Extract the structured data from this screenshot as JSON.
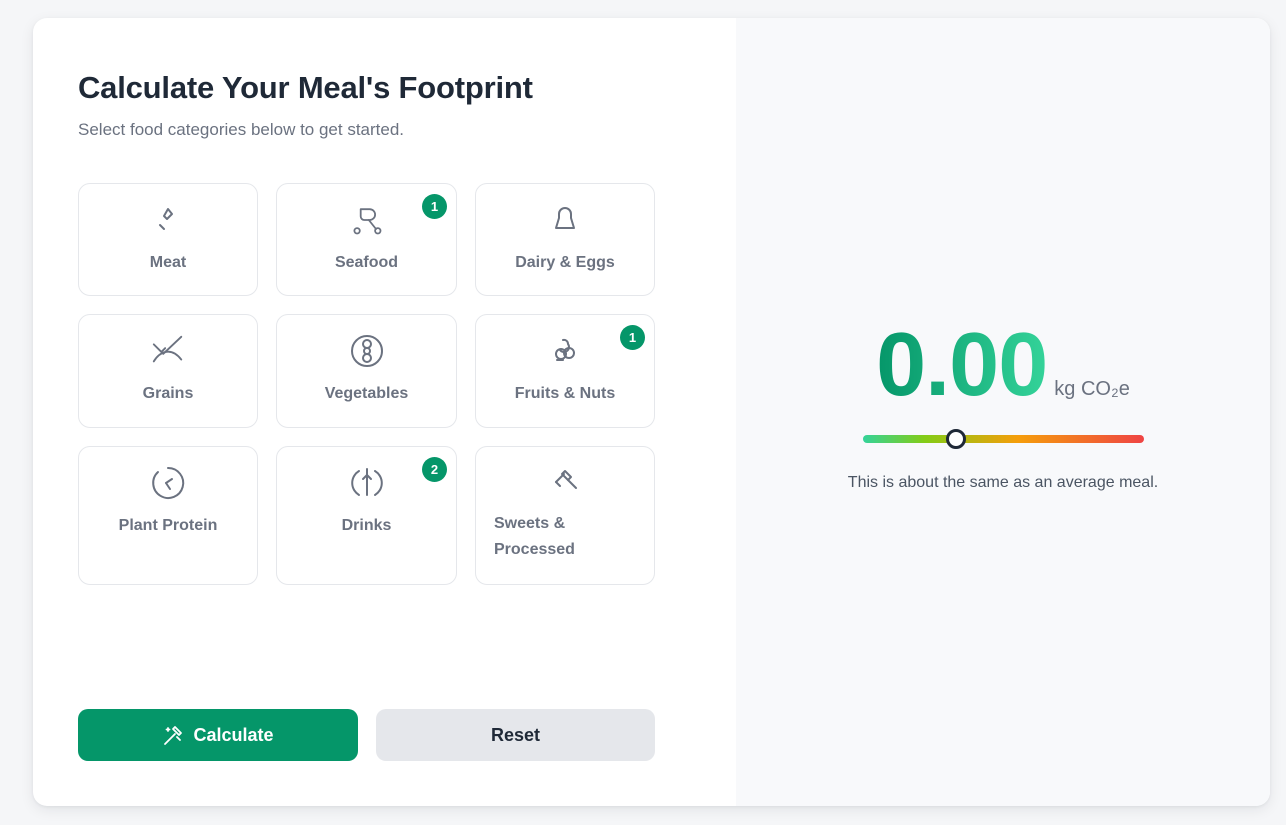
{
  "page": {
    "title": "Calculate Your Meal's Footprint",
    "subtitle": "Select food categories below to get started."
  },
  "categories": [
    {
      "label": "Meat",
      "icon": "meat-icon",
      "count": null
    },
    {
      "label": "Seafood",
      "icon": "seafood-icon",
      "count": "1"
    },
    {
      "label": "Dairy & Eggs",
      "icon": "dairy-icon",
      "count": null
    },
    {
      "label": "Grains",
      "icon": "grains-icon",
      "count": null
    },
    {
      "label": "Vegetables",
      "icon": "vegetables-icon",
      "count": null
    },
    {
      "label": "Fruits & Nuts",
      "icon": "fruits-icon",
      "count": "1"
    },
    {
      "label": "Plant Protein",
      "icon": "plant-protein-icon",
      "count": null
    },
    {
      "label": "Drinks",
      "icon": "drinks-icon",
      "count": "2"
    },
    {
      "label": "Sweets & Processed",
      "icon": "sweets-icon",
      "count": null
    }
  ],
  "actions": {
    "calculate_label": "Calculate",
    "reset_label": "Reset"
  },
  "result": {
    "value": "0.00",
    "unit": "kg CO₂e",
    "scale_position": 0.33,
    "comparison": "This is about the same as an average meal."
  },
  "colors": {
    "accent": "#059669",
    "badge": "#059669",
    "scale_low": "#34d399",
    "scale_mid": "#f59e0b",
    "scale_high": "#ef4444"
  }
}
